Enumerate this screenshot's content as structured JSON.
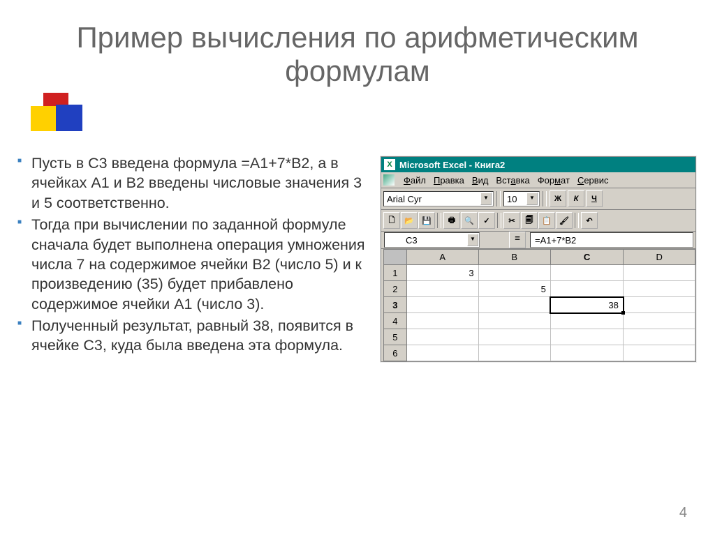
{
  "title": "Пример вычисления по арифметическим формулам",
  "bullets": [
    "Пусть в С3 введена формула =А1+7*В2, а в ячейках А1 и В2 введены числовые значения 3 и 5 соответственно.",
    "Тогда при вычислении по заданной формуле сначала будет выполнена операция умножения числа 7 на содержимое ячейки В2 (число 5) и к произведению (35) будет прибавлено содержимое ячейки А1 (число 3).",
    "Полученный результат, равный 38, появится в ячейке С3, куда была введена эта формула."
  ],
  "excel": {
    "window_title": "Microsoft Excel - Книга2",
    "menus": [
      "Файл",
      "Правка",
      "Вид",
      "Вставка",
      "Формат",
      "Сервис"
    ],
    "font": "Arial Cyr",
    "fontsize": "10",
    "style_k": "Ж",
    "style_i": "К",
    "style_u": "Ч",
    "active_cell": "C3",
    "formula": "=A1+7*B2",
    "cols": [
      "A",
      "B",
      "C",
      "D"
    ],
    "rows": [
      "1",
      "2",
      "3",
      "4",
      "5",
      "6"
    ],
    "values": {
      "A1": "3",
      "B2": "5",
      "C3": "38"
    }
  },
  "page_number": "4"
}
